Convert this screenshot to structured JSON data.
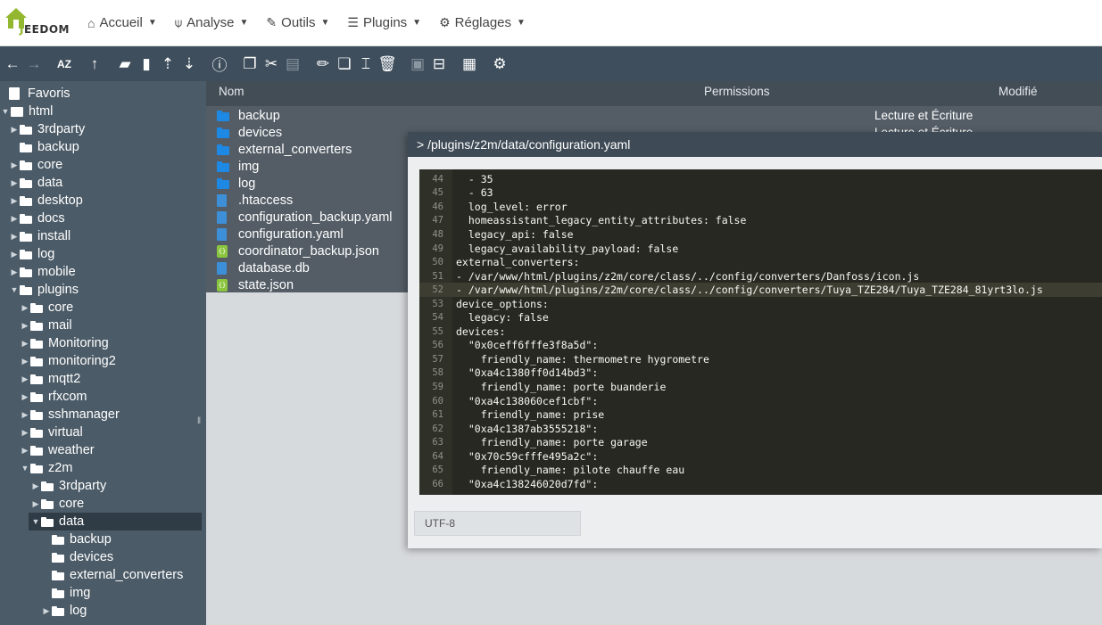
{
  "navbar": {
    "logo_text_e": "J",
    "logo_text": "EEDOM",
    "items": [
      {
        "label": "Accueil",
        "icon": "home-icon"
      },
      {
        "label": "Analyse",
        "icon": "analysis-icon"
      },
      {
        "label": "Outils",
        "icon": "wrench-icon"
      },
      {
        "label": "Plugins",
        "icon": "list-icon"
      },
      {
        "label": "Réglages",
        "icon": "gear-icon"
      }
    ]
  },
  "toolbar": {
    "icons": [
      "back-icon",
      "forward-icon",
      "sort-az-icon",
      "up-icon",
      "new-folder-icon",
      "new-file-icon",
      "upload-icon",
      "download-icon",
      "info-icon",
      "copy-icon",
      "cut-icon",
      "paste-icon",
      "edit-icon",
      "duplicate-icon",
      "rename-icon",
      "delete-icon",
      "archive-icon",
      "extract-icon",
      "view-grid-icon",
      "settings-icon"
    ]
  },
  "sidebar": {
    "favorites": "Favoris",
    "root": "html",
    "items": [
      "3rdparty",
      "backup",
      "core",
      "data",
      "desktop",
      "docs",
      "install",
      "log",
      "mobile",
      "plugins",
      "core",
      "mail",
      "Monitoring",
      "monitoring2",
      "mqtt2",
      "rfxcom",
      "sshmanager",
      "virtual",
      "weather",
      "z2m",
      "3rdparty",
      "core",
      "data",
      "backup",
      "devices",
      "external_converters",
      "img",
      "log"
    ]
  },
  "filelist": {
    "headers": {
      "name": "Nom",
      "permissions": "Permissions",
      "modified": "Modifié"
    },
    "files": [
      {
        "name": "backup",
        "type": "folder"
      },
      {
        "name": "devices",
        "type": "folder"
      },
      {
        "name": "external_converters",
        "type": "folder"
      },
      {
        "name": "img",
        "type": "folder"
      },
      {
        "name": "log",
        "type": "folder"
      },
      {
        "name": ".htaccess",
        "type": "doc"
      },
      {
        "name": "configuration_backup.yaml",
        "type": "doc"
      },
      {
        "name": "configuration.yaml",
        "type": "doc"
      },
      {
        "name": "coordinator_backup.json",
        "type": "json"
      },
      {
        "name": "database.db",
        "type": "doc"
      },
      {
        "name": "state.json",
        "type": "json"
      }
    ],
    "perm_row1": "Lecture et Écriture",
    "perm_row2": "Lecture et Écriture"
  },
  "modal": {
    "title": "> /plugins/z2m/data/configuration.yaml",
    "encoding": "UTF-8",
    "lines": [
      {
        "n": "44",
        "t": "  - 35"
      },
      {
        "n": "45",
        "t": "  - 63"
      },
      {
        "n": "46",
        "t": "  log_level: error"
      },
      {
        "n": "47",
        "t": "  homeassistant_legacy_entity_attributes: false"
      },
      {
        "n": "48",
        "t": "  legacy_api: false"
      },
      {
        "n": "49",
        "t": "  legacy_availability_payload: false"
      },
      {
        "n": "50",
        "t": "external_converters:"
      },
      {
        "n": "51",
        "t": "- /var/www/html/plugins/z2m/core/class/../config/converters/Danfoss/icon.js"
      },
      {
        "n": "52",
        "t": "- /var/www/html/plugins/z2m/core/class/../config/converters/Tuya_TZE284/Tuya_TZE284_81yrt3lo.js"
      },
      {
        "n": "53",
        "t": "device_options:"
      },
      {
        "n": "54",
        "t": "  legacy: false"
      },
      {
        "n": "55",
        "t": "devices:"
      },
      {
        "n": "56",
        "t": "  \"0x0ceff6fffe3f8a5d\":"
      },
      {
        "n": "57",
        "t": "    friendly_name: thermometre hygrometre"
      },
      {
        "n": "58",
        "t": "  \"0xa4c1380ff0d14bd3\":"
      },
      {
        "n": "59",
        "t": "    friendly_name: porte buanderie"
      },
      {
        "n": "60",
        "t": "  \"0xa4c138060cef1cbf\":"
      },
      {
        "n": "61",
        "t": "    friendly_name: prise"
      },
      {
        "n": "62",
        "t": "  \"0xa4c1387ab3555218\":"
      },
      {
        "n": "63",
        "t": "    friendly_name: porte garage"
      },
      {
        "n": "64",
        "t": "  \"0x70c59cfffe495a2c\":"
      },
      {
        "n": "65",
        "t": "    friendly_name: pilote chauffe eau"
      },
      {
        "n": "66",
        "t": "  \"0xa4c138246020d7fd\":"
      }
    ]
  }
}
